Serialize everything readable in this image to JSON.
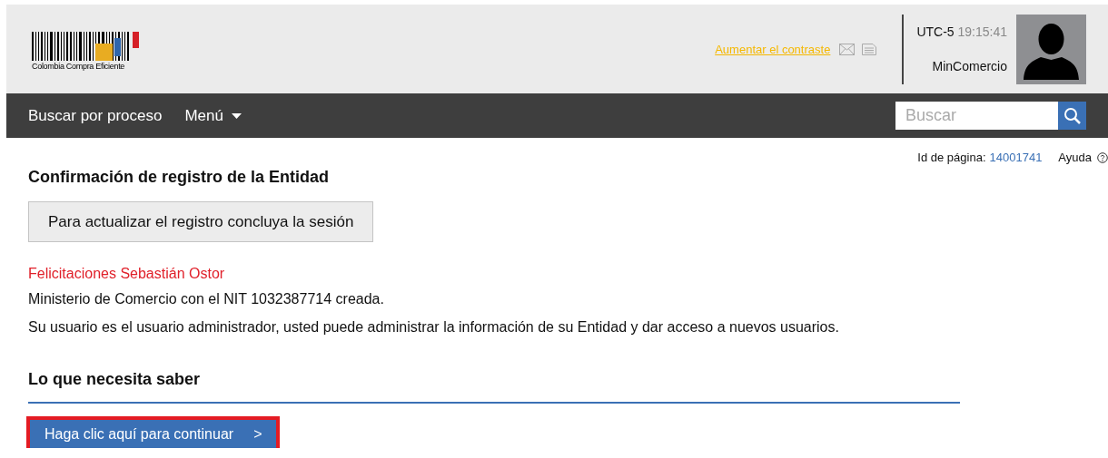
{
  "header": {
    "logo_text": "Colombia Compra Eficiente",
    "contrast_link": "Aumentar el contraste",
    "timezone": "UTC-5",
    "time": "19:15:41",
    "user": "MinComercio"
  },
  "nav": {
    "items": [
      {
        "label": "Buscar por proceso",
        "kind": "link"
      },
      {
        "label": "Menú",
        "kind": "dropdown"
      }
    ],
    "search": {
      "placeholder": "Buscar"
    }
  },
  "page_info": {
    "id_label": "Id de página:",
    "id_value": "14001741",
    "help": "Ayuda"
  },
  "title": "Confirmación de registro de la Entidad",
  "session_button": "Para actualizar el registro concluya la sesión",
  "greeting": "Felicitaciones Sebastián Ostor",
  "messages": [
    "Ministerio de Comercio con el NIT 1032387714 creada.",
    "Su usuario es el usuario administrador, usted puede administrar la información de su Entidad y dar acceso a nuevos usuarios."
  ],
  "section_title": "Lo que necesita saber",
  "continue_button": {
    "label": "Haga clic aquí para continuar",
    "arrow": ">",
    "highlighted": true
  }
}
